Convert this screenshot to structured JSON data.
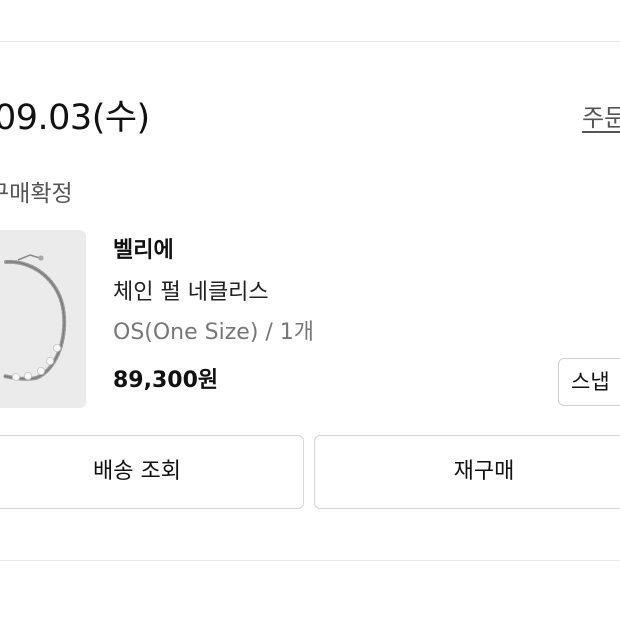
{
  "order": {
    "date": "09.03(수)",
    "detail_link": "주문 상세",
    "status": "구매확정"
  },
  "product": {
    "brand": "벨리에",
    "name": "체인 펄 네클리스",
    "option": "OS(One Size) / 1개",
    "price": "89,300원",
    "thumbnail": "pearl-chain-necklace"
  },
  "buttons": {
    "snap": "스냅",
    "track_delivery": "배송 조회",
    "rebuy": "재구매"
  }
}
